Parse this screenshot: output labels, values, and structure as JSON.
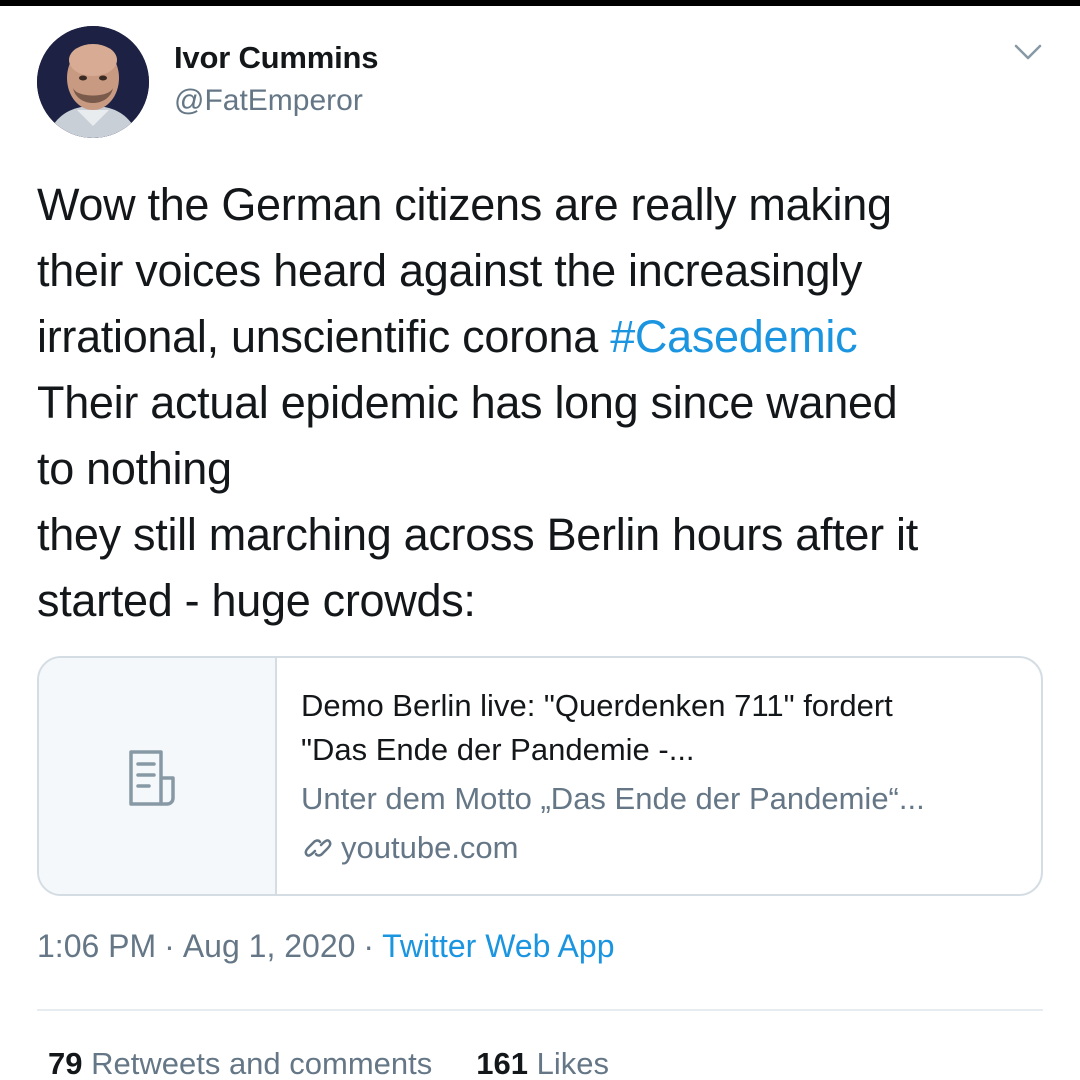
{
  "author": {
    "display_name": "Ivor Cummins",
    "handle": "@FatEmperor"
  },
  "tweet": {
    "lines": [
      "Wow the German citizens are really making",
      "their voices heard against the increasingly",
      "irrational, unscientific corona ",
      "Their actual epidemic has long since waned",
      "to nothing",
      "they still marching across Berlin hours after it",
      "started - huge crowds:"
    ],
    "hashtag": "#Casedemic"
  },
  "link_card": {
    "title_line_1": "Demo Berlin live: \"Querdenken 711\" fordert",
    "title_line_2": "\"Das Ende der Pandemie -...",
    "description": "Unter dem Motto „Das Ende der Pandemie“...",
    "domain": "youtube.com",
    "thumbnail_icon": "document-icon",
    "domain_icon": "link-icon"
  },
  "meta": {
    "time": "1:06 PM",
    "separator": "·",
    "date": "Aug 1, 2020",
    "source": "Twitter Web App"
  },
  "stats": {
    "retweets_count": "79",
    "retweets_label": "Retweets and comments",
    "likes_count": "161",
    "likes_label": "Likes"
  },
  "colors": {
    "text": "#14171a",
    "secondary": "#657786",
    "accent": "#1b95e0",
    "border": "#d5dde4"
  }
}
